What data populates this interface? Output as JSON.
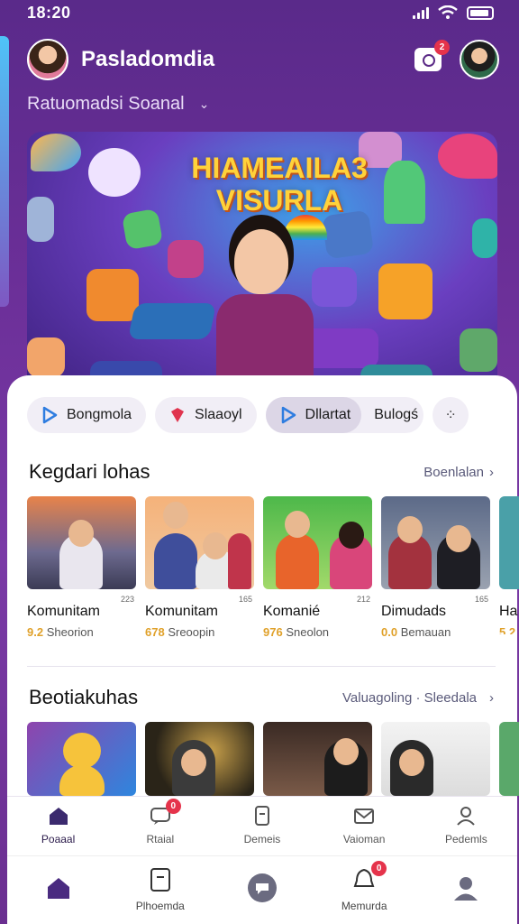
{
  "status": {
    "time": "18:20"
  },
  "header": {
    "app_title": "Pasladomdia",
    "camera_badge": "2",
    "subtitle": "Ratuomadsi Soanal"
  },
  "banner": {
    "title_line1": "HIAMEAILA3",
    "title_line2": "VISURLA"
  },
  "chips": [
    {
      "label": "Bongmola",
      "icon_color": "#2f7de0",
      "icon": "play-icon"
    },
    {
      "label": "Slaaoyl",
      "icon_color": "#e0344e",
      "icon": "heart-icon"
    },
    {
      "label": "Dllartat",
      "icon_color": "#2f7de0",
      "icon": "play-icon"
    },
    {
      "label": "Bulogś",
      "icon_color": "",
      "icon": ""
    }
  ],
  "section1": {
    "title": "Kegdari lohas",
    "link": "Boenlalan",
    "cards": [
      {
        "name": "Komunitam",
        "small": "223",
        "count": "9.2",
        "sub": "Sheorion"
      },
      {
        "name": "Komunitam",
        "small": "165",
        "count": "678",
        "sub": "Sreoopin"
      },
      {
        "name": "Komanié",
        "small": "212",
        "count": "976",
        "sub": "Sneolon"
      },
      {
        "name": "Dimudads",
        "small": "165",
        "count": "0.0",
        "sub": "Bemauan"
      },
      {
        "name": "Ha",
        "small": "",
        "count": "5.2",
        "sub": ""
      }
    ]
  },
  "section2": {
    "title": "Beotiakuhas",
    "link": "Valuagoling · Sleedala"
  },
  "tabbar": [
    {
      "label": "Poaaal",
      "icon": "home-icon",
      "active": true,
      "badge": ""
    },
    {
      "label": "Rtaial",
      "icon": "chat-icon",
      "active": false,
      "badge": "0"
    },
    {
      "label": "Demeis",
      "icon": "document-icon",
      "active": false,
      "badge": ""
    },
    {
      "label": "Vaioman",
      "icon": "mail-icon",
      "active": false,
      "badge": ""
    },
    {
      "label": "Pedemls",
      "icon": "profile-icon",
      "active": false,
      "badge": ""
    }
  ],
  "navbar": [
    {
      "label": "",
      "icon": "home-icon"
    },
    {
      "label": "Plhoemda",
      "icon": "tablet-icon"
    },
    {
      "label": "",
      "icon": "message-icon"
    },
    {
      "label": "Memurda",
      "icon": "notification-icon",
      "badge": "0"
    },
    {
      "label": "",
      "icon": "user-icon"
    }
  ],
  "colors": {
    "accent": "#5b2a86",
    "badge": "#e5334b",
    "highlight": "#e0a12a"
  }
}
